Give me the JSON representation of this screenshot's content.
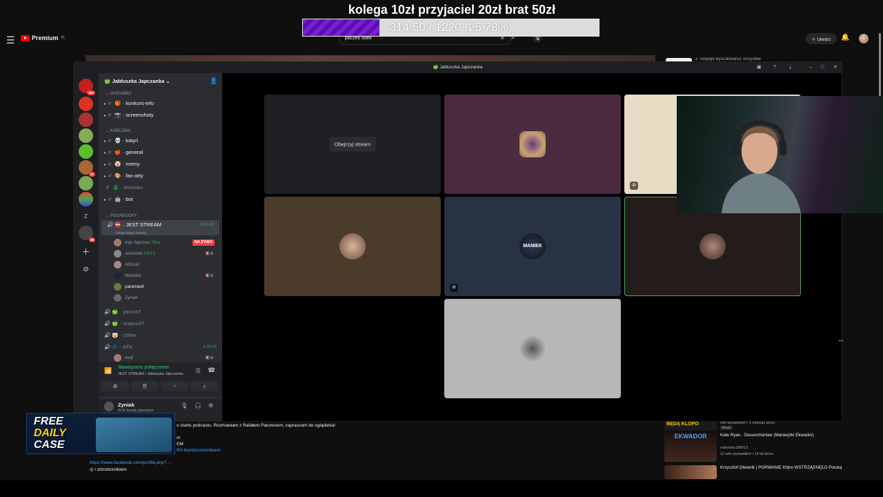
{
  "overlay": {
    "goal_title": "kolega 10zł przyjaciel 20zł brat 50zł",
    "progress_text": "314.50 / 1220 (25.78%)",
    "progress_fraction": 0.2578
  },
  "youtube": {
    "logo": "Premium",
    "logo_sup": "PL",
    "search_value": "paczes lotek",
    "create_label": "Utwórz",
    "chip_2": "Z Twojego wyszukiwania: wszystkie",
    "description_line1": "o startu podcastu. Rozmawiam z Rafałem Paczesiem, zapraszam do oglądania!",
    "description_line2": "m",
    "description_line3": "EM",
    "description_line4": "ffm.bio/dzinzkomikiem",
    "description_link1": "https://www.facebook.com/profile.php?...",
    "description_link2": "/ dzinzkomikiem",
    "recommendations": [
      {
        "title": "",
        "channel": "",
        "meta": "mln wyświetleń • 1 miesiąc temu",
        "badge": "Nowy",
        "thumb_label": "BĘDĄ KLOPO"
      },
      {
        "title": "Kate Ryan - Desenchantee (Manieczki Ekwador)",
        "channel": "mileniste199013",
        "meta": "12 mln wyświetleń • 14 lat temu",
        "badge": "",
        "thumb_label": "EKWADOR"
      },
      {
        "title": "Krzysztof Olewnik | PORWANIE Które WSTRZĄSNĘŁO Polską",
        "channel": "",
        "meta": "",
        "badge": "",
        "thumb_label": ""
      }
    ]
  },
  "free_daily_case": {
    "line1": "FREE",
    "line2": "DAILY",
    "line3": "CASE"
  },
  "discord": {
    "window_title": "Jabłuszka Japczanka",
    "server_name": "Jabłuszka Japczanka",
    "servers": [
      {
        "name": "server-1",
        "badge": "18+"
      },
      {
        "name": "server-2",
        "badge": ""
      },
      {
        "name": "server-3",
        "badge": ""
      },
      {
        "name": "server-4",
        "badge": ""
      },
      {
        "name": "server-5",
        "badge": ""
      },
      {
        "name": "server-6",
        "badge": "17"
      },
      {
        "name": "server-7",
        "badge": ""
      },
      {
        "name": "server-8",
        "badge": ""
      },
      {
        "name": "server-z",
        "badge": ""
      },
      {
        "name": "server-9",
        "badge": "65"
      }
    ],
    "categories": {
      "giveaway": "GIVEAWAY",
      "karczma": "KARCZMA",
      "pogaduchy": "POGADUCHY"
    },
    "text_channels_giveaway": [
      {
        "name": "konkurs-info",
        "emoji": "🎁"
      },
      {
        "name": "screenshoty",
        "emoji": "📸"
      }
    ],
    "text_channels_karczma": [
      {
        "name": "katyń",
        "emoji": "💀"
      },
      {
        "name": "general",
        "emoji": "🍎"
      },
      {
        "name": "memy",
        "emoji": "🤡"
      },
      {
        "name": "fan-arty",
        "emoji": "🎨"
      },
      {
        "name": "drzewko",
        "emoji": "🌲"
      },
      {
        "name": "bot",
        "emoji": "🤖"
      }
    ],
    "voice_active": {
      "name": "JEST STREAM",
      "timer": "5:49:41",
      "status": "Ustaw status kanału"
    },
    "voice_users": [
      {
        "name": "mgr Japczan",
        "tag": "78sq",
        "live": "NA ŻYWO"
      },
      {
        "name": "Alchemik",
        "tag": "EMT2",
        "live": ""
      },
      {
        "name": "AliScali",
        "tag": "",
        "live": ""
      },
      {
        "name": "Maniekk",
        "tag": "",
        "live": ""
      },
      {
        "name": "paramaxll",
        "tag": "",
        "live": ""
      },
      {
        "name": "Zyniak",
        "tag": "",
        "live": ""
      }
    ],
    "voice_channels": [
      {
        "name": "japczaT",
        "timer": ""
      },
      {
        "name": "srapczaT",
        "timer": ""
      },
      {
        "name": "chlew",
        "timer": ""
      },
      {
        "name": "AFK",
        "timer": "4:36:46"
      }
    ],
    "afk_user": "mejf",
    "voice_panel": {
      "status": "Nawiązano połączenie",
      "sub": "JEST STREAM / Jabłuszka Japczanka"
    },
    "user_panel": {
      "name": "Zyniak",
      "sub": "W tle kanału głosowym"
    },
    "watch_stream": "Obejrzyj stream",
    "tile_text_maniek": "MANIEK"
  }
}
